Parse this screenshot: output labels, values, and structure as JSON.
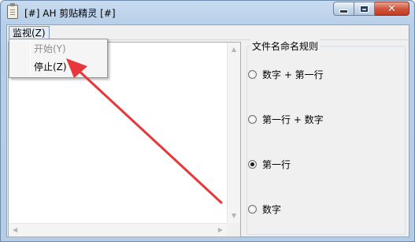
{
  "window": {
    "title": "[#] AH 剪贴精灵 [#]",
    "close_glyph": "✕"
  },
  "menubar": {
    "monitor_label": "监视(Z)"
  },
  "dropdown": {
    "items": [
      {
        "label": "开始(Y)",
        "enabled": false
      },
      {
        "label": "停止(Z)",
        "enabled": true
      }
    ]
  },
  "naming_rules": {
    "group_title": "文件名命名规则",
    "options": [
      {
        "label": "数字 + 第一行",
        "selected": false
      },
      {
        "label": "第一行 + 数字",
        "selected": false
      },
      {
        "label": "第一行",
        "selected": true
      },
      {
        "label": "数字",
        "selected": false
      }
    ]
  },
  "scroll_arrows": {
    "up": "▲",
    "down": "▼",
    "left": "◀",
    "right": "▶"
  },
  "colors": {
    "annotation_arrow": "#e8373a",
    "close_button": "#c9432a"
  }
}
